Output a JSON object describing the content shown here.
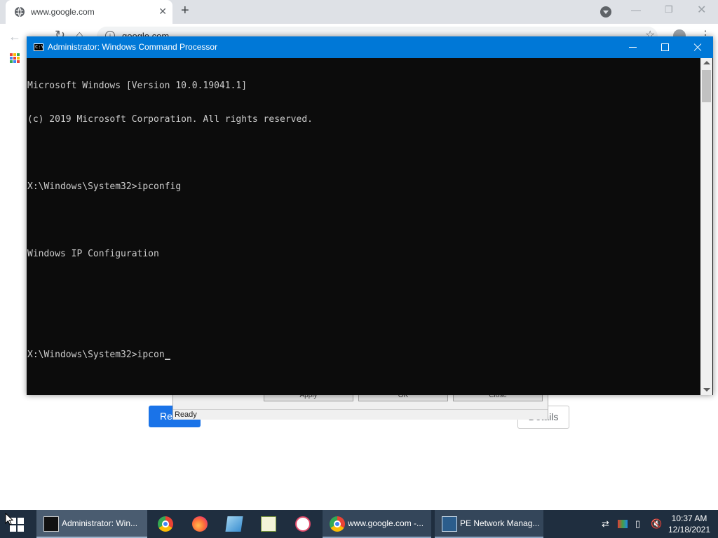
{
  "browser": {
    "tab_title": "www.google.com",
    "new_tab": "+",
    "tab_close": "✕",
    "url": "google.com",
    "reset_label": "Re",
    "details_label": "Details"
  },
  "pe_dialog": {
    "buttons": [
      "Apply",
      "OK",
      "Close"
    ],
    "status": "Ready"
  },
  "cmd": {
    "title": "Administrator: Windows Command Processor",
    "lines": [
      "Microsoft Windows [Version 10.0.19041.1]",
      "(c) 2019 Microsoft Corporation. All rights reserved.",
      "",
      "X:\\Windows\\System32>ipconfig",
      "",
      "Windows IP Configuration",
      "",
      "",
      "X:\\Windows\\System32>ipcon"
    ]
  },
  "taskbar": {
    "items": [
      {
        "label": "Administrator: Win...",
        "icon": "cmd-icon"
      },
      {
        "label": "www.google.com -...",
        "icon": "chrome-icon"
      },
      {
        "label": "PE Network Manag...",
        "icon": "network-manager-icon"
      }
    ],
    "pinned_icons": [
      "chrome-icon",
      "firefox-icon",
      "notepad-icon",
      "editor-icon",
      "paint-icon"
    ],
    "clock_time": "10:37 AM",
    "clock_date": "12/18/2021"
  }
}
